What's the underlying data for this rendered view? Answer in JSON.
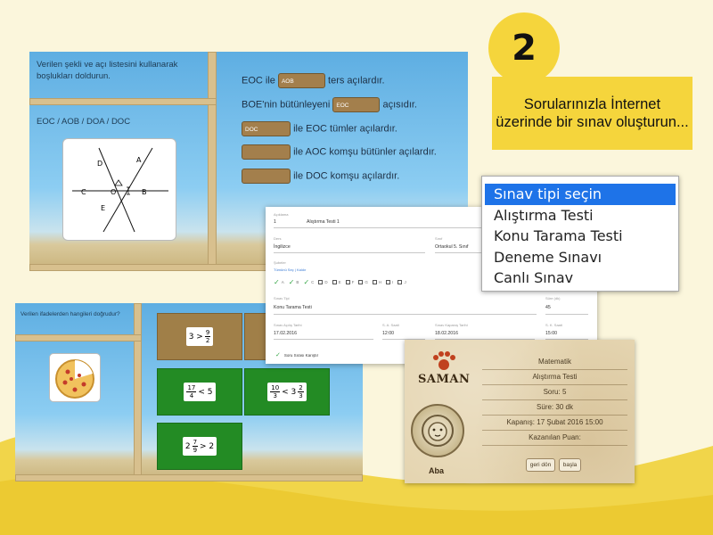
{
  "step": {
    "number": "2",
    "headline": "Sorularınızla İnternet üzerinde bir sınav oluşturun..."
  },
  "colors": {
    "yellow": "#f5d53c",
    "sky": "#6fb7e4",
    "green_tile": "#238b24",
    "brown_tile": "#a07f48",
    "selected_blue": "#1e73e8"
  },
  "angles_activity": {
    "instruction": "Verilen şekli ve açı listesini kullanarak boşlukları doldurun.",
    "angle_list": "EOC / AOB / DOA / DOC",
    "figure_labels": {
      "d": "D",
      "a": "A",
      "c": "C",
      "o": "O",
      "b": "B",
      "e": "E"
    },
    "lines": [
      {
        "pre": "EOC ile",
        "blank": "AOB",
        "post": "ters açılardır."
      },
      {
        "pre": "BOE'nin bütünleyeni",
        "blank": "EOC",
        "post": "açısıdır."
      },
      {
        "pre": "",
        "blank": "DOC",
        "post": "ile EOC tümler açılardır."
      },
      {
        "pre": "",
        "blank": "",
        "post": "ile AOC komşu bütünler açılardır."
      },
      {
        "pre": "",
        "blank": "",
        "post": "ile DOC komşu açılardır."
      }
    ]
  },
  "exam_type_dropdown": {
    "items": [
      "Sınav tipi seçin",
      "Alıştırma Testi",
      "Konu Tarama Testi",
      "Deneme Sınavı",
      "Canlı Sınav"
    ],
    "selected_index": 0
  },
  "exam_form": {
    "row1_label": "Açıklama",
    "row1_value_a": "1",
    "row1_value_b": "Alıştırma Testi 1",
    "ders_label": "Ders",
    "ders_value": "İngilizce",
    "sinif_label": "Sınıf",
    "sinif_value": "Ortaokul 5. Sınıf",
    "sube_label": "Şubeler",
    "sube_links": "Tümünü Seç | Kaldır",
    "sube_options": [
      "A",
      "B",
      "C",
      "D",
      "E",
      "F",
      "G",
      "H",
      "I",
      "J"
    ],
    "sube_checked": [
      true,
      true,
      true,
      false,
      false,
      false,
      false,
      false,
      false,
      false
    ],
    "sinav_tipi_label": "Sınav Tipi",
    "sinav_tipi_value": "Konu Tarama Testi",
    "sure_label": "Süre (dk)",
    "sure_value": "45",
    "acilis_tarih_label": "Sınav Açılış Tarihi",
    "acilis_tarih_value": "17.02.2016",
    "acilis_saat_label": "S. A. Saati",
    "acilis_saat_value": "12:00",
    "kapanis_tarih_label": "Sınav Kapanış Tarihi",
    "kapanis_tarih_value": "18.02.2016",
    "kapanis_saat_label": "S. K. Saati",
    "kapanis_saat_value": "15:00",
    "shuffle_label": "Soru Sırası Karıştır"
  },
  "fractions_activity": {
    "instruction": "Verilen ifadelerden hangileri doğrudur?",
    "tiles": [
      {
        "color": "brown",
        "whole": "3 >",
        "num": "9",
        "den": "2",
        "tail": ""
      },
      {
        "color": "brown",
        "whole": "",
        "num": "",
        "den": "",
        "tail": ""
      },
      {
        "color": "green",
        "whole": "",
        "num": "17",
        "den": "4",
        "tail": "< 5"
      },
      {
        "color": "green",
        "whole": "",
        "num": "10",
        "den": "3",
        "tail": "< 3"
      },
      {
        "color": "green",
        "whole": "2",
        "num": "7",
        "den": "9",
        "tail": "> 2"
      }
    ],
    "extra_fraction": {
      "num": "2",
      "den": "3"
    }
  },
  "game_card": {
    "brand": "SAMAN",
    "user": "Aba",
    "subject": "Matematik",
    "test_name": "Alıştırma Testi",
    "questions": "Soru: 5",
    "duration": "Süre: 30 dk",
    "deadline": "Kapanış: 17 Şubat 2016 15:00",
    "points": "Kazanılan Puan:",
    "back_button": "geri dön",
    "start_button": "başla"
  }
}
